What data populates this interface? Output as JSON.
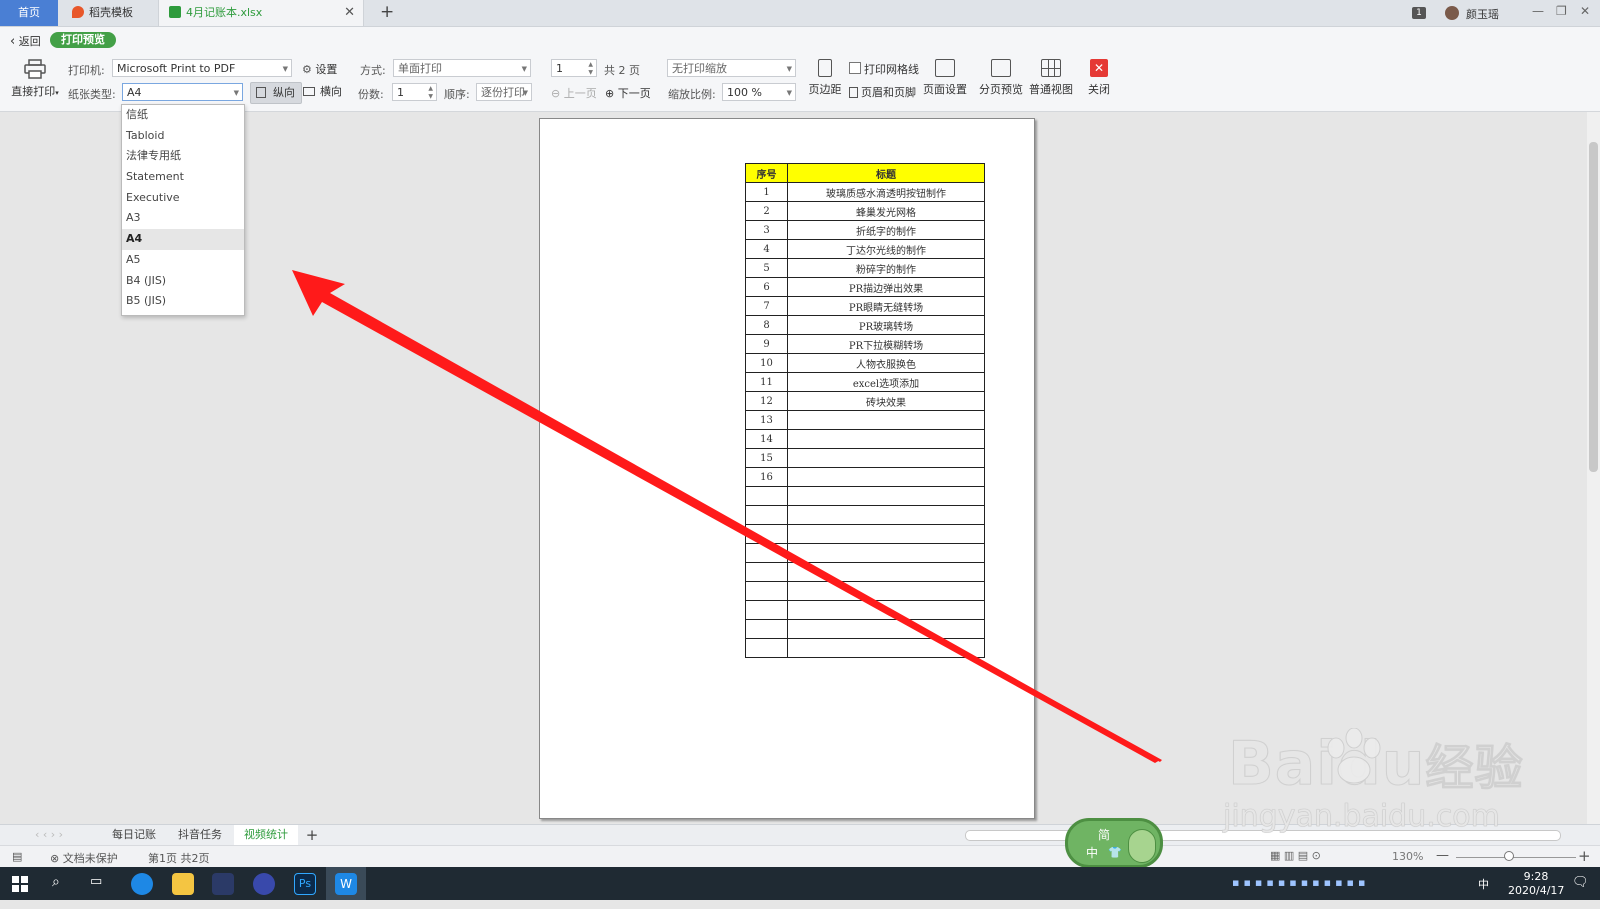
{
  "tabs": {
    "home": "首页",
    "template": "稻壳模板",
    "file": "4月记账本.xlsx",
    "new_tab_symbol": "+"
  },
  "window": {
    "badge": "1",
    "user": "颜玉瑶"
  },
  "toolbar": {
    "back": "返回",
    "mode": "打印预览",
    "direct_print": "直接打印",
    "printer_label": "打印机:",
    "printer_value": "Microsoft Print to PDF",
    "settings": "设置",
    "paper_label": "纸张类型:",
    "paper_value": "A4",
    "portrait": "纵向",
    "landscape": "横向",
    "method_label": "方式:",
    "method_value": "单面打印",
    "copies_label": "份数:",
    "copies_value": "1",
    "order_label": "顺序:",
    "order_value": "逐份打印",
    "page_value": "1",
    "total_pages": "共 2 页",
    "prev_page": "上一页",
    "next_page": "下一页",
    "scale_mode": "无打印缩放",
    "scale_label": "缩放比例:",
    "scale_value": "100 %",
    "margins": "页边距",
    "print_gridlines": "打印网格线",
    "header_footer": "页眉和页脚",
    "page_setup": "页面设置",
    "page_break_preview": "分页预览",
    "normal_view": "普通视图",
    "close": "关闭"
  },
  "paper_options": [
    "信纸",
    "Tabloid",
    "法律专用纸",
    "Statement",
    "Executive",
    "A3",
    "A4",
    "A5",
    "B4 (JIS)",
    "B5 (JIS)"
  ],
  "paper_selected": "A4",
  "table": {
    "headers": [
      "序号",
      "标题"
    ],
    "rows": [
      [
        "1",
        "玻璃质感水滴透明按钮制作"
      ],
      [
        "2",
        "蜂巢发光网格"
      ],
      [
        "3",
        "折纸字的制作"
      ],
      [
        "4",
        "丁达尔光线的制作"
      ],
      [
        "5",
        "粉碎字的制作"
      ],
      [
        "6",
        "PR描边弹出效果"
      ],
      [
        "7",
        "PR眼睛无缝转场"
      ],
      [
        "8",
        "PR玻璃转场"
      ],
      [
        "9",
        "PR下拉模糊转场"
      ],
      [
        "10",
        "人物衣服换色"
      ],
      [
        "11",
        "excel选项添加"
      ],
      [
        "12",
        "砖块效果"
      ],
      [
        "13",
        ""
      ],
      [
        "14",
        ""
      ],
      [
        "15",
        ""
      ],
      [
        "16",
        ""
      ],
      [
        "",
        ""
      ],
      [
        "",
        ""
      ],
      [
        "",
        ""
      ],
      [
        "",
        ""
      ],
      [
        "",
        ""
      ],
      [
        "",
        ""
      ],
      [
        "",
        ""
      ],
      [
        "",
        ""
      ],
      [
        "",
        ""
      ]
    ]
  },
  "sheets": {
    "tabs": [
      "每日记账",
      "抖音任务",
      "视频统计"
    ],
    "active": "视频统计",
    "add": "+"
  },
  "status": {
    "protection": "文档未保护",
    "page_info": "第1页 共2页",
    "zoom": "130%"
  },
  "ime": {
    "top": "简",
    "bottom": "中"
  },
  "taskbar": {
    "ime_mode": "中",
    "time": "9:28",
    "date": "2020/4/17"
  },
  "watermark": {
    "brand": "Bai",
    "brand2": "du",
    "cn": "经验",
    "url": "jingyan.baidu.com"
  },
  "colors": {
    "accent_green": "#43a047",
    "home_tab_blue": "#4a7fd4",
    "header_yellow": "#ffff00",
    "arrow_red": "#ff1a1a",
    "close_red": "#e53935"
  }
}
